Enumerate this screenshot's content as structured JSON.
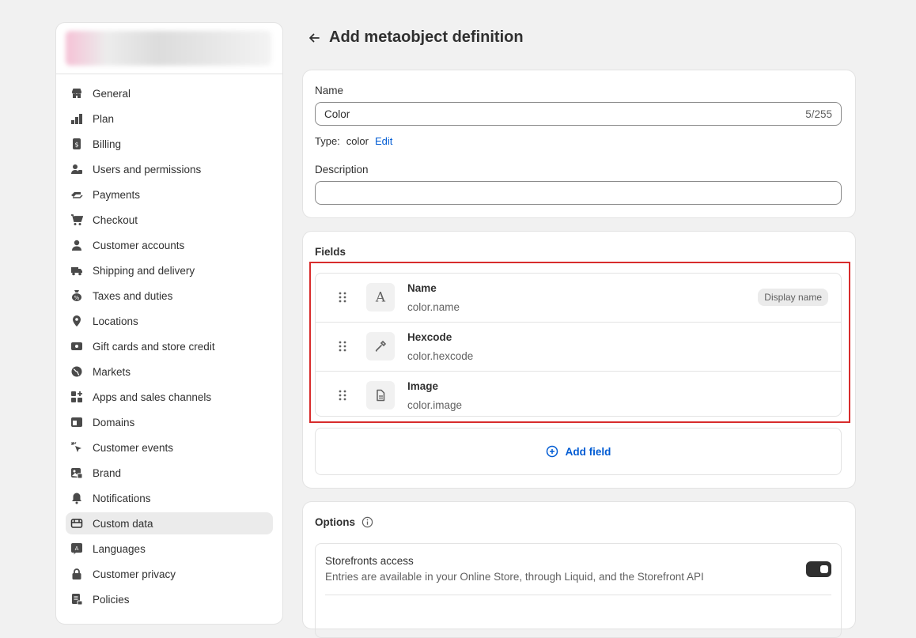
{
  "sidebar": {
    "items": [
      {
        "label": "General",
        "icon": "store-icon"
      },
      {
        "label": "Plan",
        "icon": "plan-icon"
      },
      {
        "label": "Billing",
        "icon": "billing-icon"
      },
      {
        "label": "Users and permissions",
        "icon": "users-icon"
      },
      {
        "label": "Payments",
        "icon": "payments-icon"
      },
      {
        "label": "Checkout",
        "icon": "cart-icon"
      },
      {
        "label": "Customer accounts",
        "icon": "person-icon"
      },
      {
        "label": "Shipping and delivery",
        "icon": "truck-icon"
      },
      {
        "label": "Taxes and duties",
        "icon": "tax-icon"
      },
      {
        "label": "Locations",
        "icon": "location-pin-icon"
      },
      {
        "label": "Gift cards and store credit",
        "icon": "gift-card-icon"
      },
      {
        "label": "Markets",
        "icon": "globe-icon"
      },
      {
        "label": "Apps and sales channels",
        "icon": "apps-icon"
      },
      {
        "label": "Domains",
        "icon": "domains-icon"
      },
      {
        "label": "Customer events",
        "icon": "cursor-click-icon"
      },
      {
        "label": "Brand",
        "icon": "brand-icon"
      },
      {
        "label": "Notifications",
        "icon": "bell-icon"
      },
      {
        "label": "Custom data",
        "icon": "custom-data-icon",
        "active": true
      },
      {
        "label": "Languages",
        "icon": "languages-icon"
      },
      {
        "label": "Customer privacy",
        "icon": "lock-icon"
      },
      {
        "label": "Policies",
        "icon": "policies-icon"
      }
    ]
  },
  "header": {
    "title": "Add metaobject definition"
  },
  "definition": {
    "name_label": "Name",
    "name_value": "Color",
    "name_counter": "5/255",
    "type_label": "Type:",
    "type_value": "color",
    "type_edit": "Edit",
    "description_label": "Description",
    "description_value": ""
  },
  "fields": {
    "title": "Fields",
    "items": [
      {
        "name": "Name",
        "key": "color.name",
        "icon": "text-icon",
        "badge": "Display name"
      },
      {
        "name": "Hexcode",
        "key": "color.hexcode",
        "icon": "eyedropper-icon",
        "badge": ""
      },
      {
        "name": "Image",
        "key": "color.image",
        "icon": "file-icon",
        "badge": ""
      }
    ],
    "add_label": "Add field"
  },
  "options": {
    "title": "Options",
    "storefront_title": "Storefronts access",
    "storefront_desc": "Entries are available in your Online Store, through Liquid, and the Storefront API",
    "storefront_enabled": true
  },
  "colors": {
    "accent": "#005bd3",
    "highlight": "#d82c2c",
    "toggle": "#303030"
  }
}
